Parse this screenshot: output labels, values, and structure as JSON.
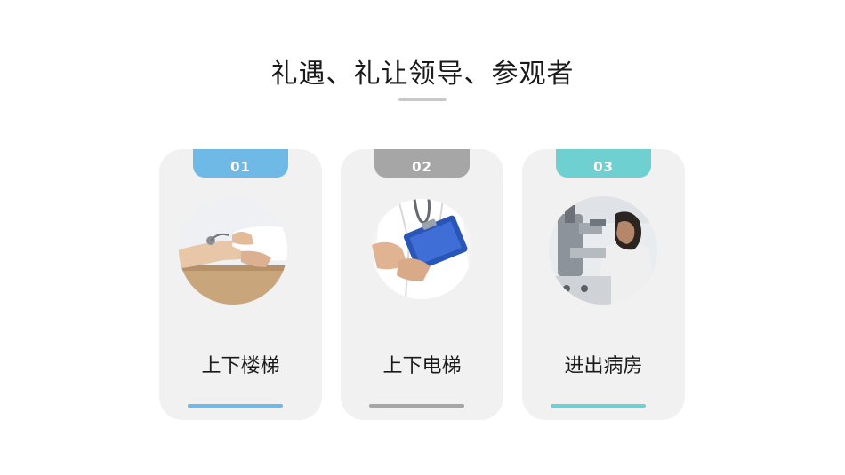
{
  "title": "礼遇、礼让领导、参观者",
  "colors": {
    "blue": "#6fb9e6",
    "gray": "#a6a6a6",
    "teal": "#6fd0d2",
    "card_bg": "#f1f1f1"
  },
  "cards": [
    {
      "number": "01",
      "label": "上下楼梯",
      "accent": "blue",
      "image": "doctor-taking-patient-pulse-photo"
    },
    {
      "number": "02",
      "label": "上下电梯",
      "accent": "gray",
      "image": "doctor-holding-clipboard-photo"
    },
    {
      "number": "03",
      "label": "进出病房",
      "accent": "teal",
      "image": "scientist-using-microscope-photo"
    }
  ]
}
